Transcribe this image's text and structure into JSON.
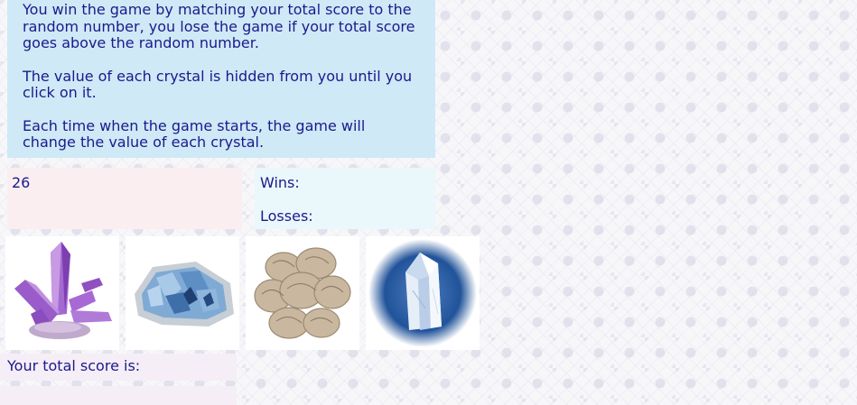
{
  "instructions": {
    "p1": "You win the game by matching your total score to the random number, you lose the game if your total score goes above the random number.",
    "p2": "The value of each crystal is hidden from you until you click on it.",
    "p3": "Each time when the game starts, the game will change the value of each crystal."
  },
  "target_number": "26",
  "record": {
    "wins_label": "Wins:",
    "wins_value": "",
    "losses_label": "Losses:",
    "losses_value": ""
  },
  "crystals": [
    {
      "icon": "amethyst-crystal-icon",
      "color": "#9b59c8"
    },
    {
      "icon": "celestite-crystal-icon",
      "color": "#5a8fc0"
    },
    {
      "icon": "desert-rose-crystal-icon",
      "color": "#b7a58c"
    },
    {
      "icon": "quartz-crystal-icon",
      "color": "#2a5aa0"
    }
  ],
  "score": {
    "label": "Your total score is:",
    "value": ""
  }
}
